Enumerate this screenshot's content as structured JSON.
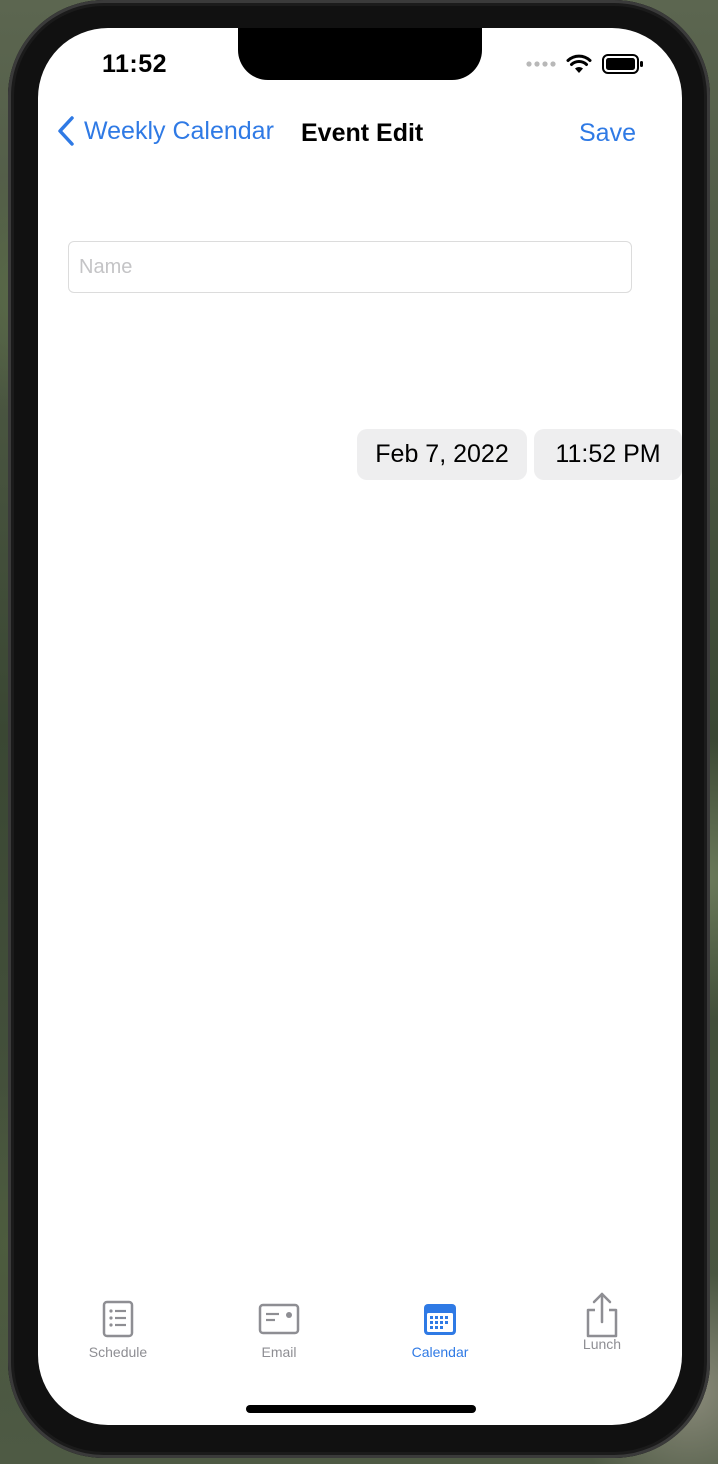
{
  "status": {
    "time": "11:52",
    "icons": [
      "cellular-dots-icon",
      "wifi-icon",
      "battery-icon"
    ]
  },
  "nav": {
    "back_label": "Weekly Calendar",
    "title": "Event Edit",
    "save_label": "Save"
  },
  "form": {
    "name_placeholder": "Name",
    "name_value": "",
    "date_value": "Feb 7, 2022",
    "time_value": "11:52 PM"
  },
  "tabs": [
    {
      "label": "Schedule",
      "icon": "schedule-icon",
      "active": false
    },
    {
      "label": "Email",
      "icon": "email-icon",
      "active": false
    },
    {
      "label": "Calendar",
      "icon": "calendar-icon",
      "active": true
    },
    {
      "label": "Lunch",
      "icon": "share-icon",
      "active": false
    }
  ],
  "colors": {
    "accent": "#2f7ae5",
    "inactive_tab": "#8e8e93",
    "pill_bg": "#eeeeef"
  }
}
